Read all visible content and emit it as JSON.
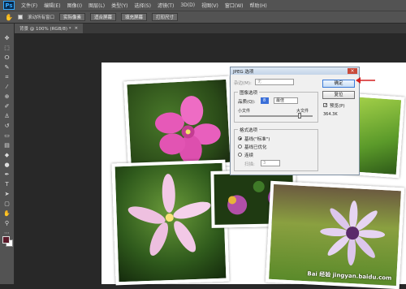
{
  "app": {
    "logo": "Ps"
  },
  "menu": [
    "文件(F)",
    "编辑(E)",
    "图像(I)",
    "图层(L)",
    "类型(Y)",
    "选择(S)",
    "滤镜(T)",
    "3D(D)",
    "视图(V)",
    "窗口(W)",
    "帮助(H)"
  ],
  "options": {
    "scroll_all": "滚动所有窗口",
    "buttons": [
      "实际像素",
      "适合屏幕",
      "填充屏幕",
      "打印尺寸"
    ]
  },
  "doc_tab": {
    "label": "背景 @ 100% (RGB/8) *",
    "close": "×"
  },
  "dialog": {
    "title": "JPEG 选项",
    "close": "×",
    "matte_label": "杂边(M):",
    "matte_value": "无",
    "image_options": "图像选项",
    "quality_label": "品质(Q):",
    "quality_value": "8",
    "quality_level": "最佳",
    "small_file": "小文件",
    "large_file": "大文件",
    "format_options": "格式选项",
    "radio1": "基线(\"标准\")",
    "radio2": "基线已优化",
    "radio3": "连续",
    "scan_label": "扫描:",
    "scan_value": "3",
    "ok": "确定",
    "reset": "复位",
    "preview_label": "预览(P)",
    "file_size": "364.3K"
  },
  "watermark": "Bai 经验  jingyan.baidu.com",
  "colors": {
    "fg": "#5b1a2a",
    "accent_arrow": "#d42020"
  }
}
